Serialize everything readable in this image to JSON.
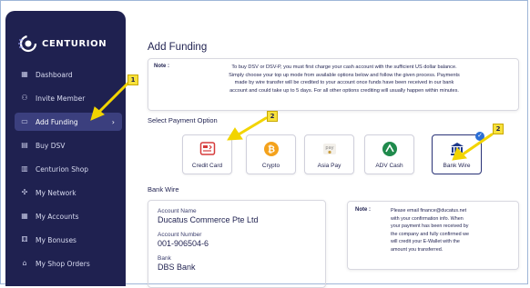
{
  "brand": {
    "name": "CENTURION"
  },
  "sidebar": {
    "items": [
      {
        "label": "Dashboard",
        "icon": "grid-icon"
      },
      {
        "label": "Invite Member",
        "icon": "people-icon"
      },
      {
        "label": "Add Funding",
        "icon": "wallet-icon",
        "active": true
      },
      {
        "label": "Buy DSV",
        "icon": "cart-icon"
      },
      {
        "label": "Centurion Shop",
        "icon": "shop-icon"
      },
      {
        "label": "My Network",
        "icon": "network-icon"
      },
      {
        "label": "My Accounts",
        "icon": "accounts-icon"
      },
      {
        "label": "My Bonuses",
        "icon": "bonus-icon"
      },
      {
        "label": "My Shop Orders",
        "icon": "bag-icon"
      }
    ]
  },
  "main": {
    "title": "Add Funding",
    "note_label": "Note :",
    "note_lines": [
      "To buy DSV or DSV-P, you must first charge your cash account with the sufficient US dollar balance.",
      "Simply choose your top up mode from available options below and follow the given process. Payments",
      "made by wire transfer will be credited to your account once funds have been received in our bank",
      "account and could take up to 5 days. For all other options crediting will usually happen within minutes."
    ],
    "payment_heading": "Select Payment Option",
    "payment_options": [
      {
        "label": "Credit Card",
        "icon": "credit-card-icon"
      },
      {
        "label": "Crypto",
        "icon": "bitcoin-icon"
      },
      {
        "label": "Asia Pay",
        "icon": "asiapay-icon"
      },
      {
        "label": "ADV Cash",
        "icon": "advcash-icon"
      },
      {
        "label": "Bank Wire",
        "icon": "bank-icon",
        "selected": true
      }
    ],
    "bank_wire": {
      "heading": "Bank Wire",
      "account_name_label": "Account Name",
      "account_name": "Ducatus Commerce Pte Ltd",
      "account_number_label": "Account Number",
      "account_number": "001-906504-6",
      "bank_label": "Bank",
      "bank": "DBS Bank"
    },
    "note2_label": "Note :",
    "note2_lines": [
      "Please email finance@ducatus.net",
      "with your confirmation info. When",
      "your payment has been received by",
      "the company and fully confirmed we",
      "will credit your E-Wallet with the",
      "amount you transferred."
    ]
  },
  "annotations": [
    "1",
    "2",
    "2"
  ],
  "colors": {
    "sidebar": "#1f2150",
    "accent": "#f7e13c",
    "arrow": "#f2d400"
  }
}
